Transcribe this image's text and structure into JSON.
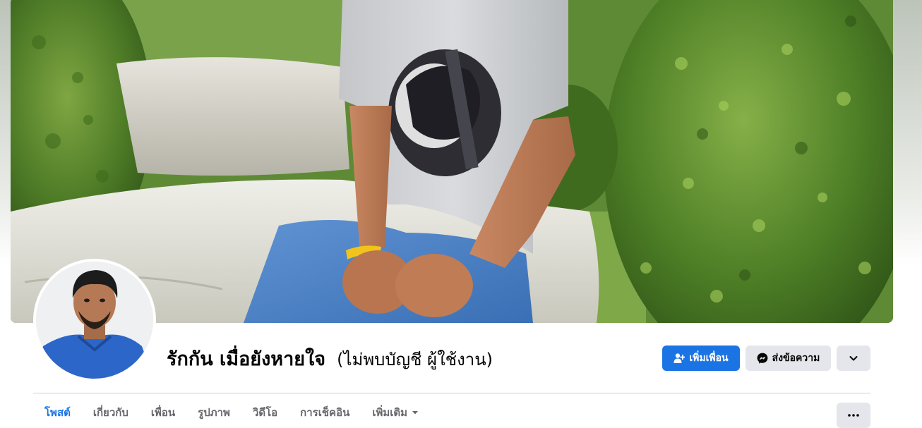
{
  "profile": {
    "name": "รักกัน เมื่อยังหายใจ",
    "alternate_name": "(ไม่พบบัญชี ผู้ใช้งาน)"
  },
  "actions": {
    "add_friend_label": "เพิ่มเพื่อน",
    "message_label": "ส่งข้อความ",
    "add_friend_icon": "person-add-icon",
    "message_icon": "messenger-icon",
    "dropdown_icon": "chevron-down-icon"
  },
  "tabs": [
    {
      "label": "โพสต์",
      "active": true
    },
    {
      "label": "เกี่ยวกับ",
      "active": false
    },
    {
      "label": "เพื่อน",
      "active": false
    },
    {
      "label": "รูปภาพ",
      "active": false
    },
    {
      "label": "วิดีโอ",
      "active": false
    },
    {
      "label": "การเช็คอิน",
      "active": false
    },
    {
      "label": "เพิ่มเติม",
      "active": false
    }
  ],
  "overflow_menu_icon": "more-horizontal-icon",
  "colors": {
    "accent": "#1b74e4",
    "secondary_button": "#e4e6eb",
    "inactive_tab_text": "#65676b"
  }
}
